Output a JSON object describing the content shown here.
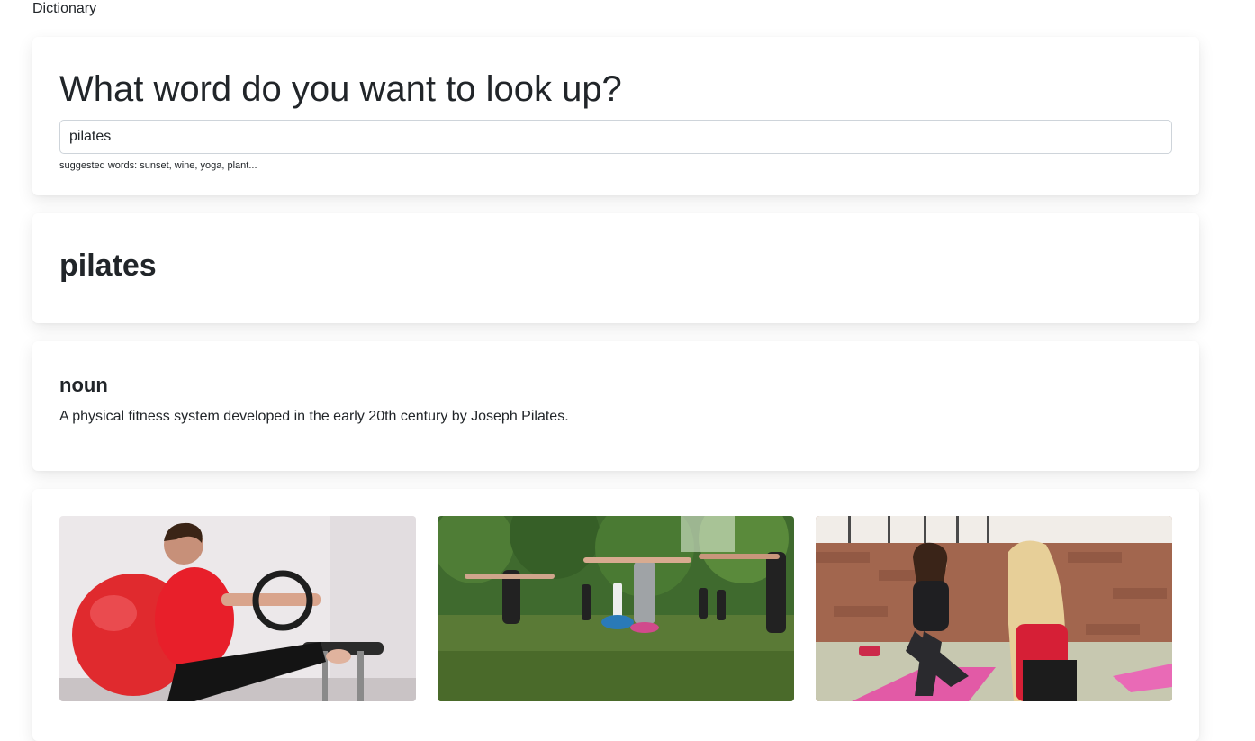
{
  "app": {
    "title": "Dictionary"
  },
  "search": {
    "heading": "What word do you want to look up?",
    "value": "pilates",
    "hint": "suggested words: sunset, wine, yoga, plant..."
  },
  "result": {
    "word": "pilates",
    "meanings": [
      {
        "part_of_speech": "noun",
        "definition": "A physical fitness system developed in the early 20th century by Joseph Pilates."
      }
    ]
  },
  "photos": [
    {
      "name": "photo-pilates-ring-ball"
    },
    {
      "name": "photo-outdoor-group-class"
    },
    {
      "name": "photo-two-women-mat"
    }
  ]
}
